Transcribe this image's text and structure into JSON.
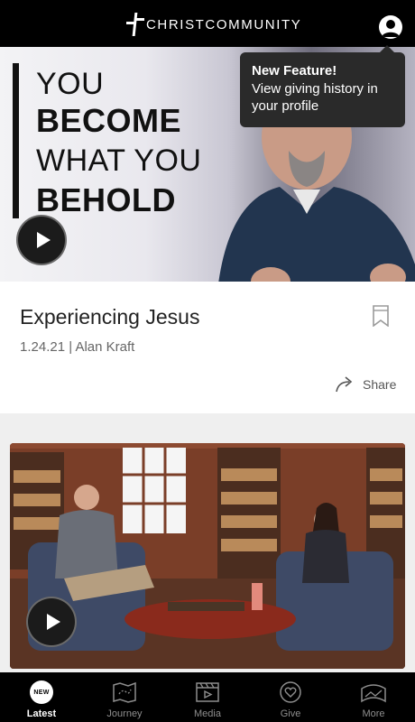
{
  "header": {
    "brand": "CHRISTCOMMUNITY",
    "logo_icon": "cross-logo-icon",
    "profile_icon": "profile-icon"
  },
  "tooltip": {
    "title": "New Feature!",
    "body": "View giving history in your profile"
  },
  "hero": {
    "lines": [
      "YOU",
      "BECOME",
      "WHAT YOU",
      "BEHOLD"
    ],
    "play_icon": "play-icon"
  },
  "sermon": {
    "title": "Experiencing Jesus",
    "meta": "1.24.21 | Alan Kraft",
    "bookmark_icon": "bookmark-icon",
    "share_label": "Share",
    "share_icon": "share-icon"
  },
  "video": {
    "play_icon": "play-icon"
  },
  "tabs": [
    {
      "label": "Latest",
      "badge": "NEW",
      "icon": "new-badge-icon",
      "active": true
    },
    {
      "label": "Journey",
      "icon": "map-icon",
      "active": false
    },
    {
      "label": "Media",
      "icon": "film-icon",
      "active": false
    },
    {
      "label": "Give",
      "icon": "heart-icon",
      "active": false
    },
    {
      "label": "More",
      "icon": "more-icon",
      "active": false
    }
  ],
  "colors": {
    "header_bg": "#000000",
    "tooltip_bg": "#2a2a2a",
    "tab_active": "#ffffff",
    "tab_inactive": "#8e8e8e"
  }
}
